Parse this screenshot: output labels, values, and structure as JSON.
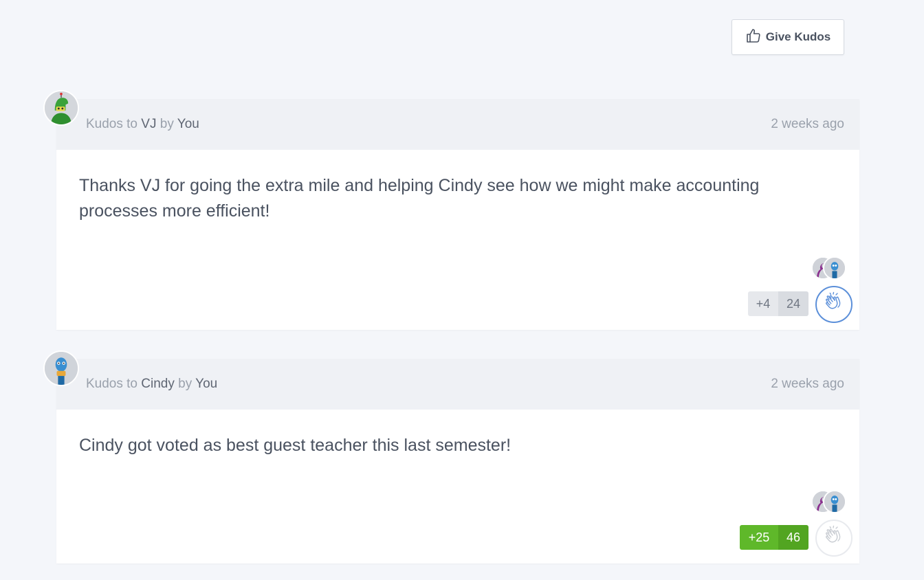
{
  "header": {
    "give_kudos_label": "Give Kudos",
    "give_kudos_icon": "thumbs-up-icon"
  },
  "kudos": [
    {
      "to_prefix": "Kudos to",
      "recipient": "VJ",
      "by_word": "by",
      "author": "You",
      "time": "2 weeks ago",
      "message": "Thanks VJ for going the extra mile and helping Cindy see how we might make accounting processes more efficient!",
      "bonus": "+4",
      "count": "24",
      "counter_style": "grey",
      "clap_state": "active",
      "avatar_color": "#3aa23a"
    },
    {
      "to_prefix": "Kudos to",
      "recipient": "Cindy",
      "by_word": "by",
      "author": "You",
      "time": "2 weeks ago",
      "message": "Cindy got voted as best guest teacher this last semester!",
      "bonus": "+25",
      "count": "46",
      "counter_style": "green",
      "clap_state": "inactive",
      "avatar_color": "#3a8fd1"
    }
  ],
  "colors": {
    "accent_blue": "#5b8fd9",
    "accent_green": "#5fb82a",
    "background": "#f4f6fa"
  }
}
